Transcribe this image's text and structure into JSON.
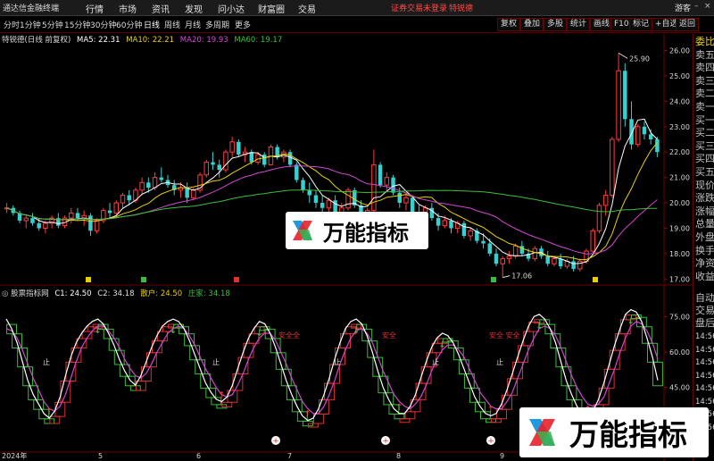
{
  "topbar": {
    "app_name": "通达信金融终端",
    "menus": [
      "行情",
      "市场",
      "资讯",
      "发现",
      "问小达",
      "财富圈",
      "交易"
    ],
    "login_status": "证券交易未登录",
    "stock_hint": "特锐德",
    "guest": "游客"
  },
  "periods": [
    "分时",
    "1分钟",
    "5分钟",
    "15分钟",
    "30分钟",
    "60分钟",
    "日线",
    "周线",
    "月线",
    "多周期",
    "更多"
  ],
  "active_period": "日线",
  "right_buttons": [
    "复权",
    "叠加",
    "多股",
    "统计",
    "画线",
    "F10",
    "标记",
    "+自选",
    "返回"
  ],
  "main_info": {
    "title": "特锐德(日线 前复权)",
    "ma5": "MA5: 22.31",
    "ma10": "MA10: 22.21",
    "ma20": "MA20: 19.93",
    "ma60": "MA60: 19.17"
  },
  "sub_info": {
    "name": "股票指标网",
    "c1": "C1: 24.50",
    "c2": "C2: 34.18",
    "sanhu": "散户: 24.50",
    "zhuangjia": "庄家: 34.18"
  },
  "side_labels": [
    "委比",
    "卖五",
    "卖四",
    "卖三",
    "卖二",
    "卖一",
    "买一",
    "买二",
    "买三",
    "买四",
    "买五",
    "现价",
    "涨跌",
    "涨幅",
    "总量",
    "外盘",
    "换手",
    "净资",
    "收益"
  ],
  "side_labels_lower": [
    "自动",
    "交易",
    "盘后"
  ],
  "side_times": [
    "14:56",
    "14:56",
    "14:56",
    "14:56",
    "14:56",
    "14:56",
    "14:56",
    "14:56"
  ],
  "price_ticks": [
    "26.00",
    "25.00",
    "24.00",
    "23.00",
    "22.00",
    "21.00",
    "20.00",
    "19.00",
    "18.00",
    "17.00"
  ],
  "sub_ticks": [
    "75.00",
    "60.00",
    "45.00",
    "30.00"
  ],
  "date_labels": [
    "2024年",
    "5",
    "6",
    "7",
    "8",
    "9"
  ],
  "annotations": {
    "high": "25.90",
    "low": "17.06",
    "red_signals": [
      "安全全",
      "安全",
      "安全 安全"
    ],
    "zhi": [
      "止",
      "止",
      "止",
      "止",
      "止"
    ]
  },
  "chart_data": {
    "type": "candlestick",
    "title": "特锐德(日线 前复权)",
    "ylim": [
      16.8,
      26.3
    ],
    "sub_ylim": [
      18,
      82
    ],
    "candles": [
      [
        19.8,
        20.0,
        19.6,
        19.8
      ],
      [
        19.8,
        19.9,
        19.5,
        19.6
      ],
      [
        19.6,
        19.7,
        19.2,
        19.3
      ],
      [
        19.3,
        19.5,
        19.0,
        19.4
      ],
      [
        19.4,
        19.6,
        19.1,
        19.2
      ],
      [
        19.2,
        19.4,
        18.9,
        19.0
      ],
      [
        19.0,
        19.3,
        18.8,
        19.2
      ],
      [
        19.2,
        19.5,
        19.0,
        19.4
      ],
      [
        19.4,
        19.6,
        19.0,
        19.1
      ],
      [
        19.1,
        19.5,
        19.0,
        19.4
      ],
      [
        19.4,
        19.8,
        19.2,
        19.6
      ],
      [
        19.6,
        19.8,
        19.3,
        19.4
      ],
      [
        19.4,
        19.7,
        19.1,
        19.5
      ],
      [
        19.5,
        19.6,
        18.7,
        18.9
      ],
      [
        18.9,
        19.4,
        18.8,
        19.3
      ],
      [
        19.3,
        19.8,
        19.2,
        19.7
      ],
      [
        19.7,
        20.0,
        19.4,
        19.6
      ],
      [
        19.6,
        20.1,
        19.5,
        20.0
      ],
      [
        20.0,
        20.4,
        19.8,
        20.3
      ],
      [
        20.3,
        20.5,
        19.9,
        20.1
      ],
      [
        20.1,
        20.6,
        20.0,
        20.5
      ],
      [
        20.5,
        21.0,
        20.3,
        20.8
      ],
      [
        20.8,
        21.0,
        20.4,
        20.6
      ],
      [
        20.6,
        21.2,
        20.5,
        21.0
      ],
      [
        21.0,
        21.4,
        20.8,
        20.9
      ],
      [
        20.9,
        21.1,
        20.6,
        20.7
      ],
      [
        20.7,
        20.9,
        20.3,
        20.5
      ],
      [
        20.5,
        20.8,
        20.2,
        20.6
      ],
      [
        20.6,
        20.8,
        20.0,
        20.2
      ],
      [
        20.2,
        20.6,
        20.1,
        20.5
      ],
      [
        20.5,
        21.2,
        20.4,
        21.1
      ],
      [
        21.1,
        21.7,
        21.0,
        21.6
      ],
      [
        21.6,
        22.0,
        21.3,
        21.5
      ],
      [
        21.5,
        21.7,
        21.0,
        21.3
      ],
      [
        21.3,
        22.1,
        21.2,
        22.0
      ],
      [
        22.0,
        22.6,
        21.8,
        22.4
      ],
      [
        22.4,
        22.5,
        21.8,
        21.9
      ],
      [
        21.9,
        22.2,
        21.6,
        22.0
      ],
      [
        22.0,
        22.1,
        21.5,
        21.6
      ],
      [
        21.6,
        22.0,
        21.5,
        21.9
      ],
      [
        21.9,
        22.0,
        21.4,
        21.5
      ],
      [
        21.5,
        22.3,
        21.5,
        22.2
      ],
      [
        22.2,
        22.3,
        21.7,
        21.8
      ],
      [
        21.8,
        22.1,
        21.6,
        22.0
      ],
      [
        22.0,
        22.1,
        21.4,
        21.5
      ],
      [
        21.5,
        21.6,
        20.8,
        20.9
      ],
      [
        20.9,
        21.0,
        20.4,
        20.5
      ],
      [
        20.5,
        20.8,
        20.0,
        20.3
      ],
      [
        20.3,
        20.5,
        19.8,
        20.0
      ],
      [
        20.0,
        20.3,
        19.6,
        19.8
      ],
      [
        19.8,
        20.2,
        19.6,
        20.1
      ],
      [
        20.1,
        20.3,
        19.5,
        19.6
      ],
      [
        19.6,
        20.0,
        19.4,
        19.8
      ],
      [
        19.8,
        20.6,
        19.7,
        20.5
      ],
      [
        20.5,
        20.6,
        19.8,
        19.9
      ],
      [
        19.9,
        20.1,
        19.3,
        19.4
      ],
      [
        19.4,
        19.8,
        19.3,
        19.7
      ],
      [
        19.7,
        22.1,
        19.6,
        21.5
      ],
      [
        21.5,
        21.6,
        20.6,
        20.7
      ],
      [
        20.7,
        21.2,
        20.5,
        21.0
      ],
      [
        21.0,
        21.1,
        20.3,
        20.4
      ],
      [
        20.4,
        20.6,
        19.8,
        20.0
      ],
      [
        20.0,
        20.4,
        19.7,
        20.2
      ],
      [
        20.2,
        20.3,
        19.5,
        19.6
      ],
      [
        19.6,
        19.9,
        19.3,
        19.5
      ],
      [
        19.5,
        19.9,
        19.4,
        19.8
      ],
      [
        19.8,
        20.0,
        19.3,
        19.4
      ],
      [
        19.4,
        19.6,
        18.9,
        19.1
      ],
      [
        19.1,
        19.5,
        19.0,
        19.3
      ],
      [
        19.3,
        19.4,
        18.8,
        19.0
      ],
      [
        19.0,
        19.3,
        18.8,
        19.2
      ],
      [
        19.2,
        19.3,
        18.6,
        18.7
      ],
      [
        18.7,
        19.0,
        18.5,
        18.9
      ],
      [
        18.9,
        19.0,
        18.4,
        18.5
      ],
      [
        18.5,
        18.8,
        18.2,
        18.4
      ],
      [
        18.4,
        18.6,
        17.9,
        18.0
      ],
      [
        18.0,
        18.2,
        17.5,
        17.6
      ],
      [
        17.6,
        17.9,
        17.06,
        17.8
      ],
      [
        17.8,
        18.1,
        17.6,
        17.9
      ],
      [
        17.9,
        18.4,
        17.8,
        18.3
      ],
      [
        18.3,
        18.5,
        17.9,
        18.0
      ],
      [
        18.0,
        18.2,
        17.7,
        17.8
      ],
      [
        17.8,
        18.3,
        17.7,
        18.2
      ],
      [
        18.2,
        18.3,
        17.8,
        17.9
      ],
      [
        17.9,
        18.1,
        17.5,
        17.6
      ],
      [
        17.6,
        17.9,
        17.5,
        17.8
      ],
      [
        17.8,
        18.0,
        17.4,
        17.5
      ],
      [
        17.5,
        17.8,
        17.4,
        17.7
      ],
      [
        17.7,
        17.9,
        17.3,
        17.4
      ],
      [
        17.4,
        17.8,
        17.3,
        17.7
      ],
      [
        17.7,
        18.2,
        17.6,
        18.1
      ],
      [
        18.1,
        19.0,
        18.0,
        18.9
      ],
      [
        18.9,
        20.0,
        18.8,
        19.9
      ],
      [
        19.9,
        20.5,
        19.5,
        20.3
      ],
      [
        20.3,
        22.6,
        20.2,
        22.5
      ],
      [
        22.5,
        25.9,
        22.4,
        25.2
      ],
      [
        25.2,
        25.5,
        23.0,
        23.3
      ],
      [
        23.3,
        24.0,
        22.1,
        22.3
      ],
      [
        22.3,
        23.1,
        22.2,
        23.0
      ],
      [
        23.0,
        23.2,
        22.5,
        22.7
      ],
      [
        22.7,
        22.9,
        22.3,
        22.5
      ],
      [
        22.5,
        22.6,
        21.8,
        22.0
      ]
    ],
    "ma_lines": [
      {
        "name": "MA5",
        "color": "#ffffff"
      },
      {
        "name": "MA10",
        "color": "#e8d000"
      },
      {
        "name": "MA20",
        "color": "#d048d0"
      },
      {
        "name": "MA60",
        "color": "#3cbe3c"
      }
    ],
    "sub_series": [
      {
        "name": "C1",
        "color": "#ffffff",
        "values": [
          74,
          70,
          64,
          56,
          48,
          42,
          38,
          34,
          32,
          35,
          41,
          50,
          58,
          64,
          68,
          71,
          73,
          74,
          72,
          68,
          63,
          57,
          52,
          48,
          46,
          50,
          56,
          62,
          67,
          71,
          73,
          74,
          73,
          70,
          65,
          59,
          53,
          47,
          43,
          40,
          39,
          41,
          46,
          53,
          60,
          66,
          70,
          73,
          72,
          68,
          62,
          55,
          48,
          42,
          37,
          33,
          31,
          32,
          36,
          42,
          49,
          57,
          64,
          70,
          73,
          74,
          72,
          67,
          60,
          52,
          45,
          40,
          36,
          34,
          34,
          37,
          42,
          49,
          56,
          62,
          66,
          68,
          67,
          64,
          59,
          53,
          47,
          41,
          37,
          34,
          33,
          34,
          38,
          44,
          51,
          58,
          65,
          71,
          75,
          76,
          74,
          70,
          64,
          56,
          48,
          42,
          37,
          34,
          33,
          35,
          40,
          47,
          55,
          63,
          70,
          76,
          78,
          77,
          73,
          66,
          58,
          48
        ]
      },
      {
        "name": "C2",
        "color": "#d048d0",
        "values": [
          70,
          69,
          66,
          61,
          55,
          49,
          44,
          39,
          36,
          35,
          37,
          42,
          49,
          56,
          62,
          66,
          69,
          71,
          71,
          69,
          66,
          62,
          57,
          53,
          50,
          49,
          51,
          55,
          60,
          64,
          68,
          70,
          71,
          70,
          67,
          63,
          58,
          53,
          49,
          45,
          42,
          41,
          42,
          46,
          51,
          57,
          62,
          66,
          68,
          68,
          65,
          60,
          55,
          49,
          44,
          39,
          36,
          34,
          34,
          37,
          42,
          48,
          55,
          61,
          66,
          69,
          70,
          68,
          64,
          58,
          52,
          47,
          42,
          39,
          37,
          36,
          38,
          41,
          46,
          52,
          57,
          61,
          63,
          63,
          61,
          58,
          53,
          48,
          43,
          40,
          37,
          36,
          36,
          39,
          43,
          49,
          55,
          61,
          66,
          70,
          71,
          70,
          67,
          62,
          56,
          50,
          45,
          41,
          38,
          37,
          38,
          41,
          47,
          53,
          60,
          66,
          71,
          73,
          72,
          69,
          64,
          57
        ]
      }
    ]
  }
}
